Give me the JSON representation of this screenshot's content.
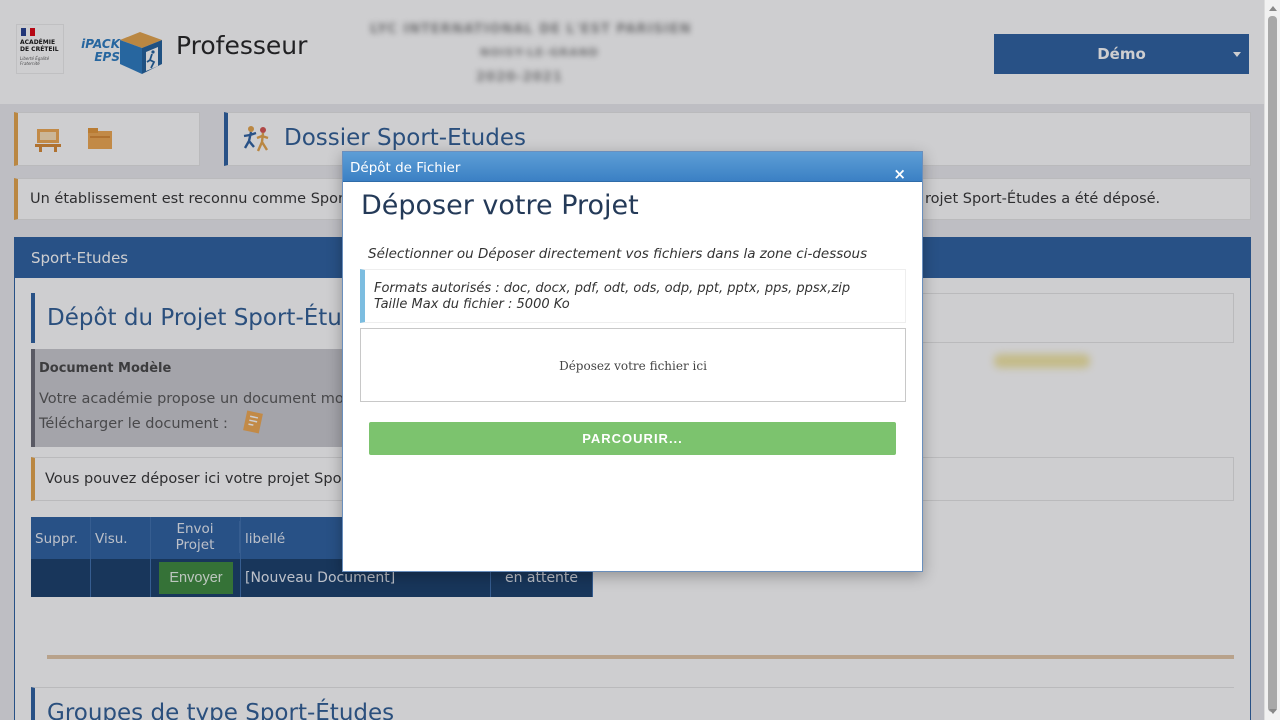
{
  "header": {
    "academie_logo_text": "ACADÉMIE DE CRÉTEIL",
    "academie_motto": "Liberté Égalité Fraternité",
    "ipack_logo_line1": "iPACK",
    "ipack_logo_line2": "EPS",
    "app_title": "Professeur",
    "blurred_line1": "LYC INTERNATIONAL DE L'EST PARISIEN",
    "blurred_line2": "NOISY-LE-GRAND",
    "blurred_line3": "2020-2021",
    "user_menu_label": "Démo"
  },
  "page": {
    "title": "Dossier Sport-Etudes",
    "info_left": "Un établissement est reconnu comme Sport-",
    "info_right": "rojet Sport-Études a été déposé.",
    "panel_title": "Sport-Etudes",
    "section_title": "Dépôt du Projet Sport-Étud",
    "doc_modele": {
      "heading": "Document Modèle",
      "line1": "Votre académie propose un document mod",
      "line2": "Télécharger le document :"
    },
    "deposit_note": "Vous pouvez déposer ici votre projet Spor",
    "table": {
      "headers": [
        "Suppr.",
        "Visu.",
        "Envoi Projet",
        "libellé",
        ""
      ],
      "envoi_header_line1": "Envoi",
      "envoi_header_line2": "Projet",
      "row": {
        "send_button": "Envoyer",
        "label": "[Nouveau Document]",
        "status": "en attente"
      }
    },
    "groupes_title": "Groupes de type Sport-Études"
  },
  "modal": {
    "header": "Dépôt de Fichier",
    "close_symbol": "×",
    "title": "Déposer votre Projet",
    "instruction": "Sélectionner ou Déposer directement vos fichiers dans la zone ci-dessous",
    "formats": "Formats autorisés : doc, docx, pdf, odt, ods, odp, ppt, pptx, pps, ppsx,zip",
    "max_size": "Taille Max du fichier : 5000 Ko",
    "dropzone_text": "Déposez votre fichier ici",
    "browse_button": "PARCOURIR..."
  },
  "colors": {
    "primary_blue": "#2b5fa0",
    "accent_orange": "#e6a44a",
    "success_green": "#7cc36e",
    "modal_header_blue": "#4a8fcd"
  },
  "icons": [
    "desk-icon",
    "folder-icon",
    "athletes-icon",
    "download-icon",
    "close-icon",
    "caret-down-icon"
  ]
}
